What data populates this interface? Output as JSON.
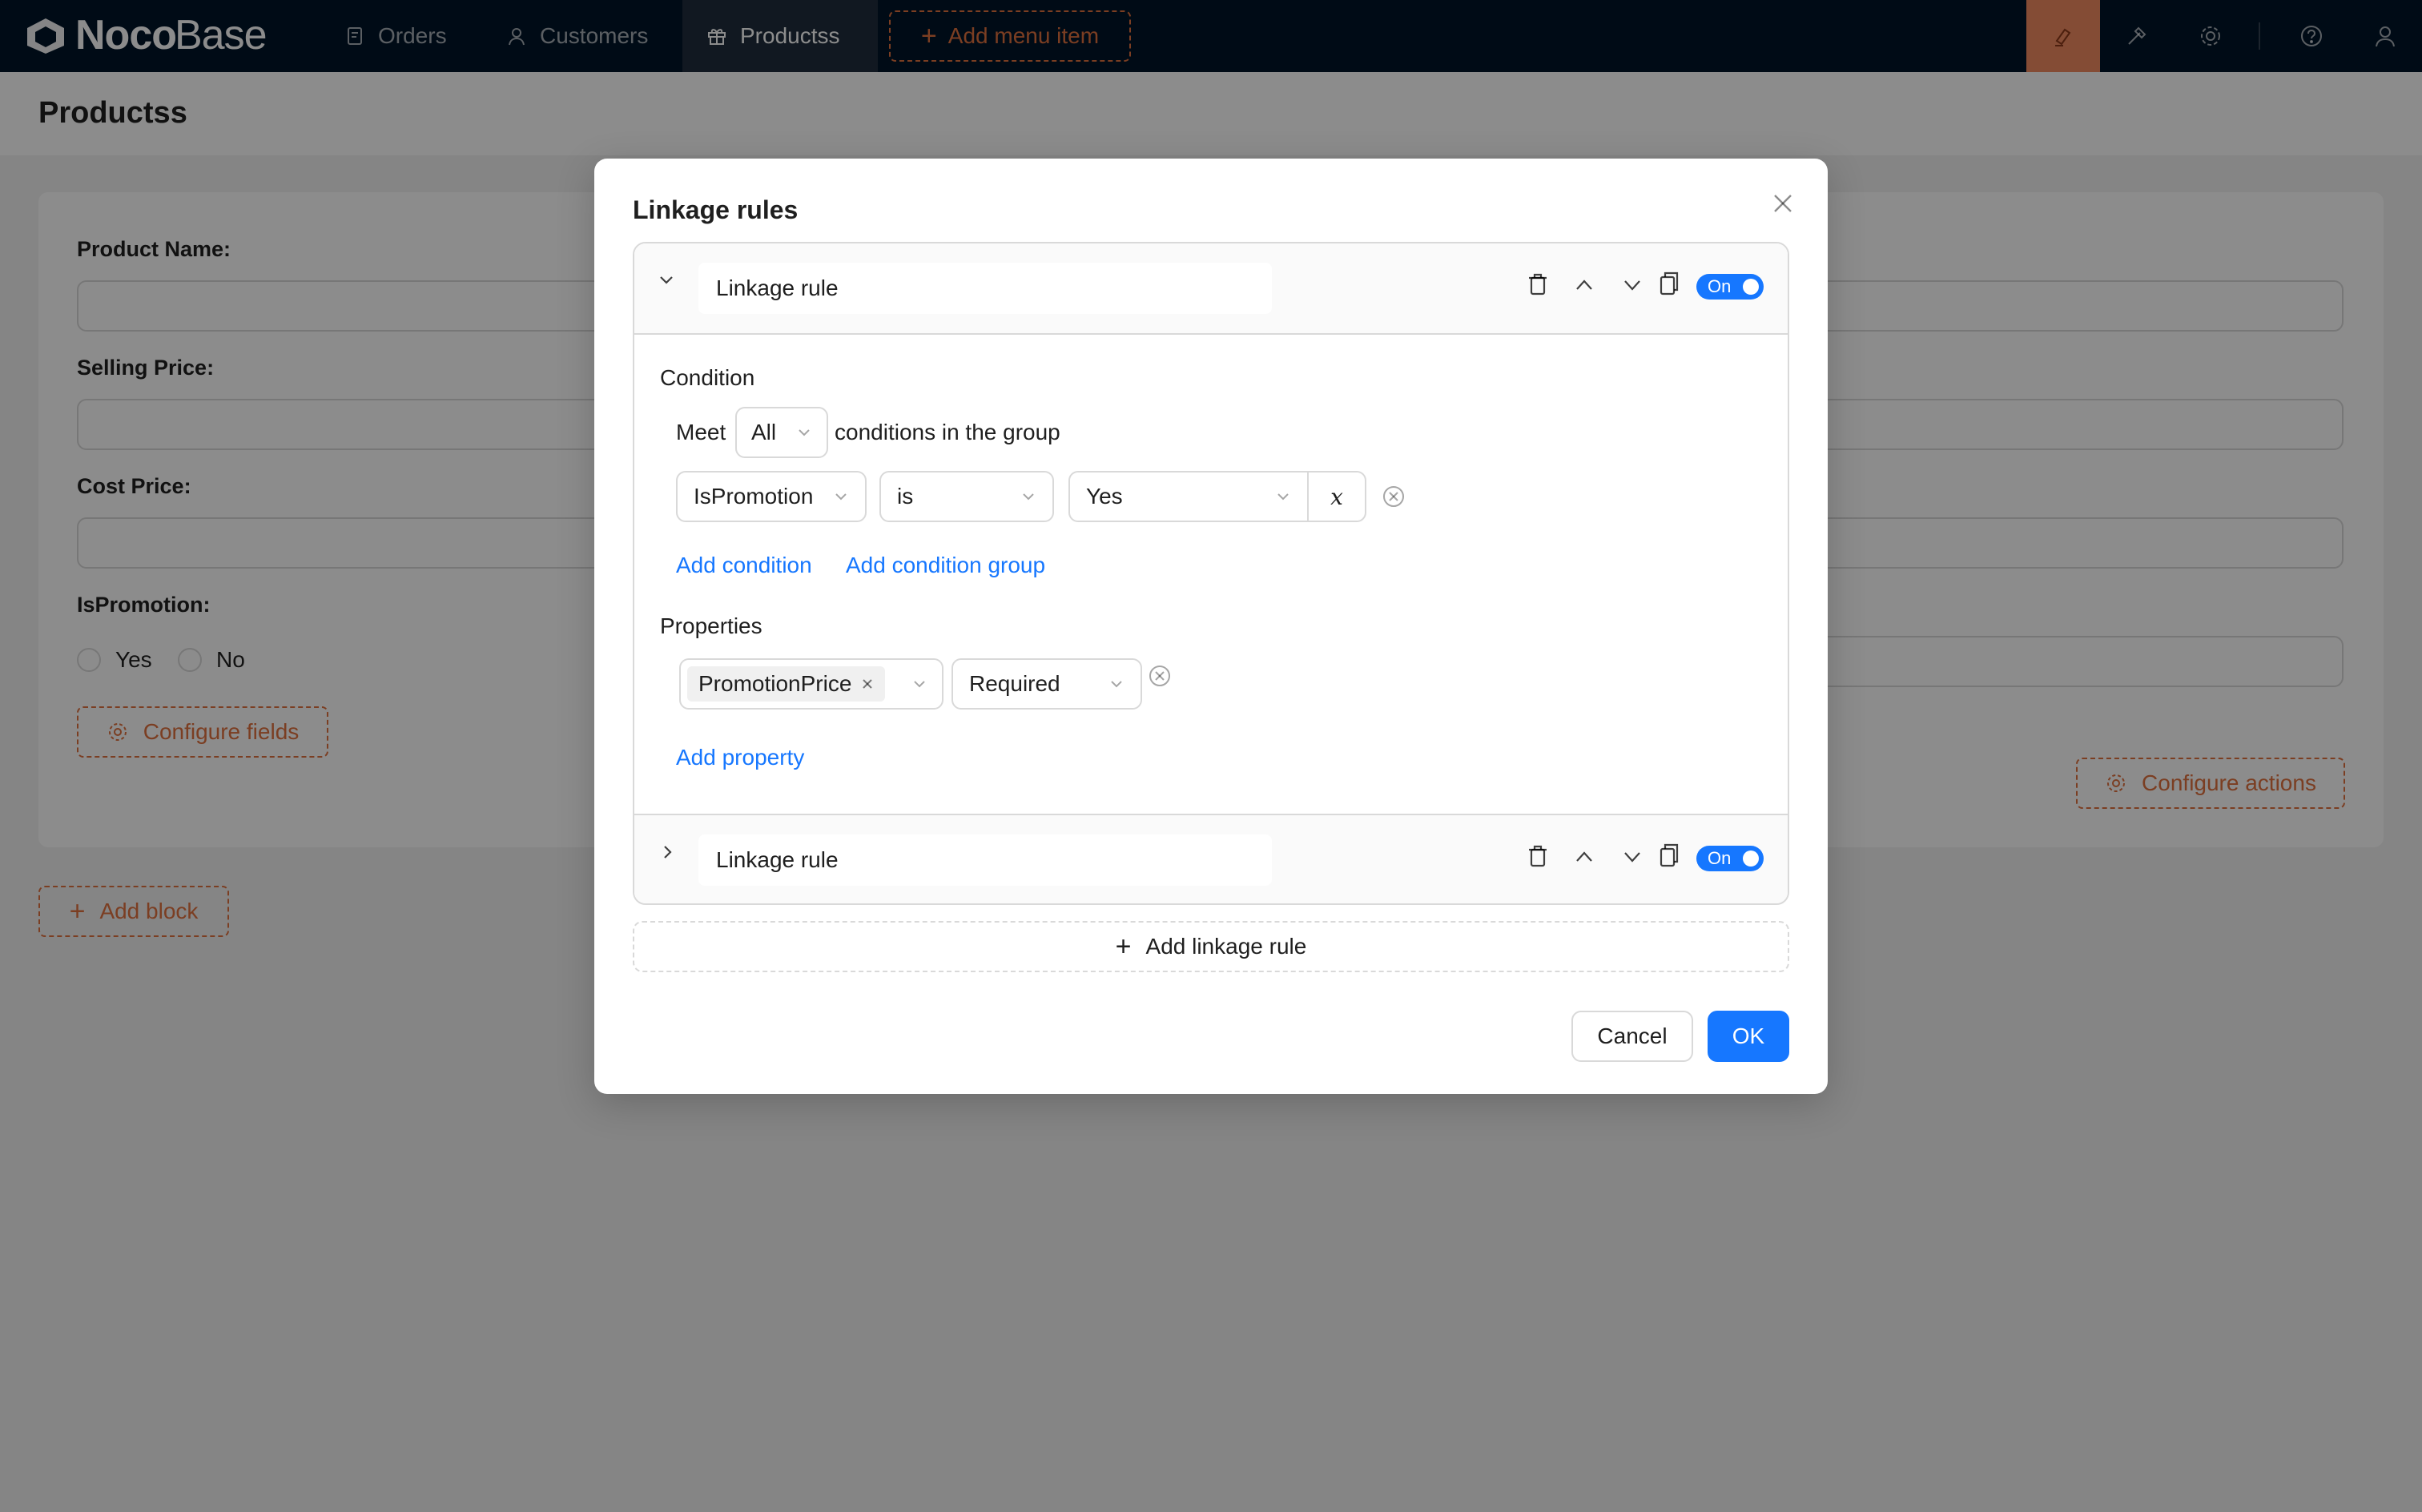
{
  "brand": {
    "name_bold": "Noco",
    "name_light": "Base"
  },
  "nav": {
    "items": [
      {
        "label": "Orders",
        "icon": "file-icon"
      },
      {
        "label": "Customers",
        "icon": "user-icon"
      },
      {
        "label": "Productss",
        "icon": "gift-icon",
        "active": true
      }
    ],
    "add_menu_item": "Add menu item"
  },
  "toolbar_icons": [
    "highlight-icon",
    "plugin-icon",
    "settings-icon",
    "help-icon",
    "user-icon"
  ],
  "page": {
    "title": "Productss"
  },
  "form": {
    "fields": [
      {
        "label": "Product Name",
        "colon": ":"
      },
      {
        "label": "Selling Price",
        "colon": ":"
      },
      {
        "label": "Cost Price",
        "colon": ":"
      },
      {
        "label": "IsPromotion",
        "colon": ":"
      }
    ],
    "radio_options": [
      "Yes",
      "No"
    ],
    "configure_fields": "Configure fields",
    "configure_actions": "Configure actions"
  },
  "add_block": "Add block",
  "modal": {
    "title": "Linkage rules",
    "rules": [
      {
        "name": "Linkage rule",
        "switch": "On",
        "expanded": true,
        "condition_label": "Condition",
        "meet_prefix": "Meet",
        "meet_value": "All",
        "meet_suffix": "conditions in the group",
        "condition": {
          "field": "IsPromotion",
          "operator": "is",
          "value": "Yes",
          "variable_symbol": "x"
        },
        "add_condition": "Add condition",
        "add_condition_group": "Add condition group",
        "properties_label": "Properties",
        "property": {
          "field": "PromotionPrice",
          "action": "Required"
        },
        "add_property": "Add property"
      },
      {
        "name": "Linkage rule",
        "switch": "On",
        "expanded": false
      }
    ],
    "add_linkage_rule": "Add linkage rule",
    "cancel": "Cancel",
    "ok": "OK"
  },
  "colors": {
    "accent": "#1677ff",
    "brand_orange": "#e0713f",
    "topbar": "#001529"
  }
}
